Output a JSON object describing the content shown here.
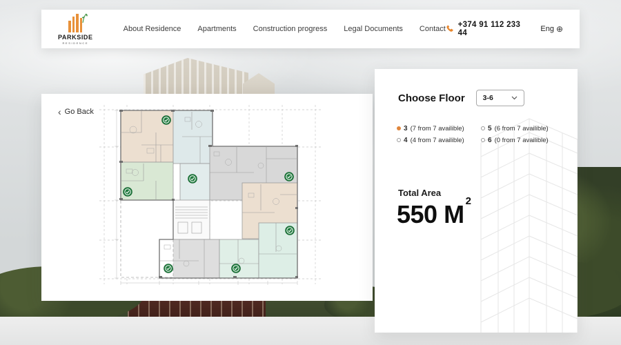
{
  "header": {
    "logo": {
      "title": "PARKSIDE",
      "subtitle": "RESIDENCE"
    },
    "nav": [
      {
        "label": "About Residence"
      },
      {
        "label": "Apartments"
      },
      {
        "label": "Construction progress"
      },
      {
        "label": "Legal Documents"
      },
      {
        "label": "Contact"
      }
    ],
    "phone": "+374 91 112 233 44",
    "language": "Eng"
  },
  "plan_card": {
    "back_label": "Go Back",
    "back_chevron": "‹"
  },
  "floor_panel": {
    "choose_floor_label": "Choose Floor",
    "selected_range": "3-6",
    "options": [
      {
        "floor": "3",
        "note": "(7 from 7 availible)",
        "selected": true
      },
      {
        "floor": "4",
        "note": "(4 from 7 availible)",
        "selected": false
      },
      {
        "floor": "5",
        "note": "(6 from 7 availible)",
        "selected": false
      },
      {
        "floor": "6",
        "note": "(0 from 7 availible)",
        "selected": false
      }
    ],
    "total_area_label": "Total Area",
    "total_area_value": "550 M",
    "total_area_sup": "2"
  },
  "icons": {
    "globe_glyph": "⊕",
    "phone_icon": "phone-handset",
    "marker_icon": "available-apartment-marker",
    "dropdown_icon": "chevron-down"
  },
  "colors": {
    "accent_orange": "#e8872e",
    "marker_green": "#1f7a3d",
    "apartment_beige": "#ecdfd0",
    "apartment_blue": "#dee9ea",
    "apartment_green": "#d9e8d4",
    "apartment_gray": "#d8d8d8",
    "apartment_teal": "#ddeee6"
  }
}
